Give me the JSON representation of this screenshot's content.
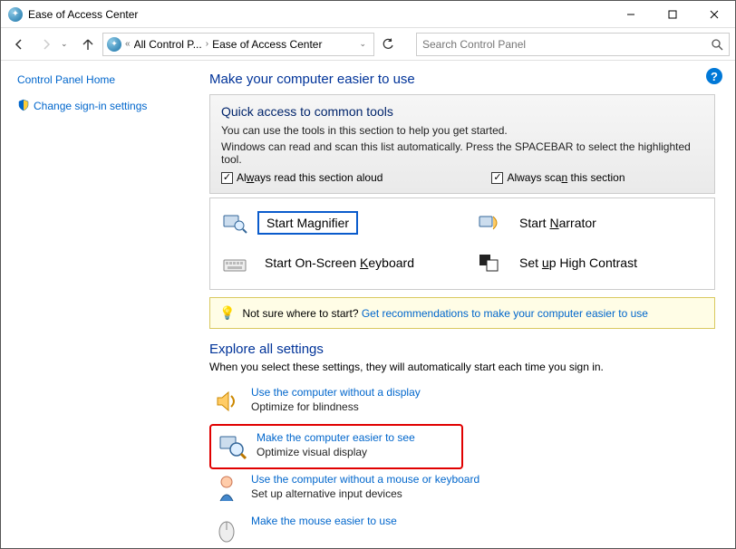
{
  "window": {
    "title": "Ease of Access Center"
  },
  "nav": {
    "breadcrumb_root": "All Control P...",
    "breadcrumb_page": "Ease of Access Center",
    "search_placeholder": "Search Control Panel"
  },
  "sidebar": {
    "home": "Control Panel Home",
    "signin": "Change sign-in settings"
  },
  "main": {
    "title": "Make your computer easier to use",
    "quick": {
      "heading": "Quick access to common tools",
      "line1": "You can use the tools in this section to help you get started.",
      "line2": "Windows can read and scan this list automatically.  Press the SPACEBAR to select the highlighted tool.",
      "chk1_pre": "Al",
      "chk1_u": "w",
      "chk1_post": "ays read this section aloud",
      "chk2_pre": "Always sca",
      "chk2_u": "n",
      "chk2_post": " this section"
    },
    "tools": {
      "magnifier_pre": "Start Ma",
      "magnifier_u": "g",
      "magnifier_post": "nifier",
      "narrator_pre": "Start ",
      "narrator_u": "N",
      "narrator_post": "arrator",
      "osk_pre": "Start On-Screen ",
      "osk_u": "K",
      "osk_post": "eyboard",
      "contrast_pre": "Set ",
      "contrast_u": "u",
      "contrast_post": "p High Contrast"
    },
    "hint": {
      "text": "Not sure where to start? ",
      "link": "Get recommendations to make your computer easier to use"
    },
    "explore": {
      "heading": "Explore all settings",
      "desc": "When you select these settings, they will automatically start each time you sign in.",
      "items": [
        {
          "link": "Use the computer without a display",
          "sub": "Optimize for blindness"
        },
        {
          "link": "Make the computer easier to see",
          "sub": "Optimize visual display"
        },
        {
          "link": "Use the computer without a mouse or keyboard",
          "sub": "Set up alternative input devices"
        },
        {
          "link": "Make the mouse easier to use",
          "sub": ""
        }
      ]
    }
  }
}
